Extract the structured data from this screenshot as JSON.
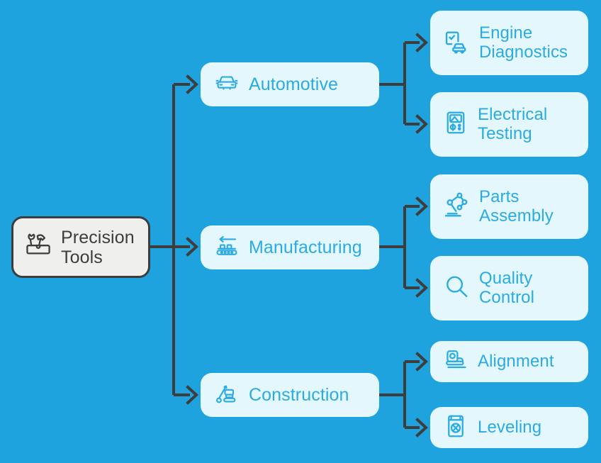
{
  "diagram": {
    "type": "mind-map",
    "background_color": "#1FA3DE",
    "node_fill": "#E4F7FD",
    "accent_color": "#2BABE2",
    "root_fill": "#EFEFED",
    "root_border": "#3D3D3D",
    "connector_color": "#3D3D3D"
  },
  "root": {
    "label": "Precision\nTools",
    "icon": "toolbox-icon"
  },
  "branches": [
    {
      "id": "automotive",
      "label": "Automotive",
      "icon": "car-front-icon",
      "children": [
        {
          "id": "engine-diagnostics",
          "label": "Engine\nDiagnostics",
          "icon": "diagnostics-clipboard-car-icon"
        },
        {
          "id": "electrical-testing",
          "label": "Electrical\nTesting",
          "icon": "multimeter-icon"
        }
      ]
    },
    {
      "id": "manufacturing",
      "label": "Manufacturing",
      "icon": "conveyor-belt-icon",
      "children": [
        {
          "id": "parts-assembly",
          "label": "Parts\nAssembly",
          "icon": "robot-arm-icon"
        },
        {
          "id": "quality-control",
          "label": "Quality\nControl",
          "icon": "magnifier-icon"
        }
      ]
    },
    {
      "id": "construction",
      "label": "Construction",
      "icon": "crane-excavator-icon",
      "children": [
        {
          "id": "alignment",
          "label": "Alignment",
          "icon": "laser-level-roller-icon"
        },
        {
          "id": "leveling",
          "label": "Leveling",
          "icon": "spirit-level-icon"
        }
      ]
    }
  ]
}
